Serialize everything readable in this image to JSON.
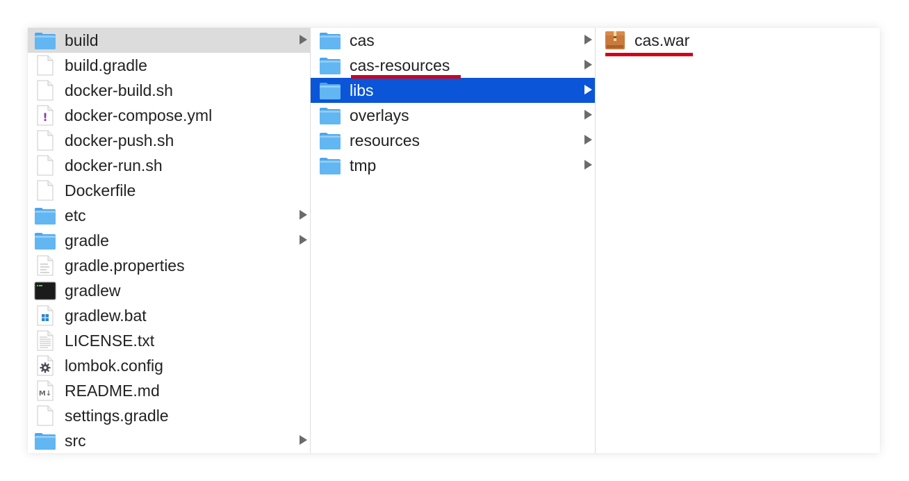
{
  "columns": [
    {
      "items": [
        {
          "name": "build",
          "kind": "folder",
          "has_children": true,
          "selected": "gray"
        },
        {
          "name": "build.gradle",
          "kind": "file-blank"
        },
        {
          "name": "docker-build.sh",
          "kind": "file-blank"
        },
        {
          "name": "docker-compose.yml",
          "kind": "file-yml"
        },
        {
          "name": "docker-push.sh",
          "kind": "file-blank"
        },
        {
          "name": "docker-run.sh",
          "kind": "file-blank"
        },
        {
          "name": "Dockerfile",
          "kind": "file-blank"
        },
        {
          "name": "etc",
          "kind": "folder",
          "has_children": true
        },
        {
          "name": "gradle",
          "kind": "folder",
          "has_children": true
        },
        {
          "name": "gradle.properties",
          "kind": "file-text"
        },
        {
          "name": "gradlew",
          "kind": "terminal"
        },
        {
          "name": "gradlew.bat",
          "kind": "file-windows"
        },
        {
          "name": "LICENSE.txt",
          "kind": "file-doc"
        },
        {
          "name": "lombok.config",
          "kind": "file-gear"
        },
        {
          "name": "README.md",
          "kind": "file-markdown"
        },
        {
          "name": "settings.gradle",
          "kind": "file-blank"
        },
        {
          "name": "src",
          "kind": "folder",
          "has_children": true
        }
      ]
    },
    {
      "items": [
        {
          "name": "cas",
          "kind": "folder",
          "has_children": true
        },
        {
          "name": "cas-resources",
          "kind": "folder",
          "has_children": true,
          "underlined": true
        },
        {
          "name": "libs",
          "kind": "folder",
          "has_children": true,
          "selected": "blue"
        },
        {
          "name": "overlays",
          "kind": "folder",
          "has_children": true
        },
        {
          "name": "resources",
          "kind": "folder",
          "has_children": true
        },
        {
          "name": "tmp",
          "kind": "folder",
          "has_children": true
        }
      ]
    },
    {
      "items": [
        {
          "name": "cas.war",
          "kind": "archive",
          "underlined": true,
          "badge": "ARCHIVE"
        }
      ]
    }
  ],
  "colors": {
    "folder_blue": "#62b6f2",
    "selection_gray": "#dcdcdc",
    "selection_blue": "#0a55d8",
    "annotation_red": "#d0021b",
    "arrow_gray": "#6b6b6b"
  }
}
